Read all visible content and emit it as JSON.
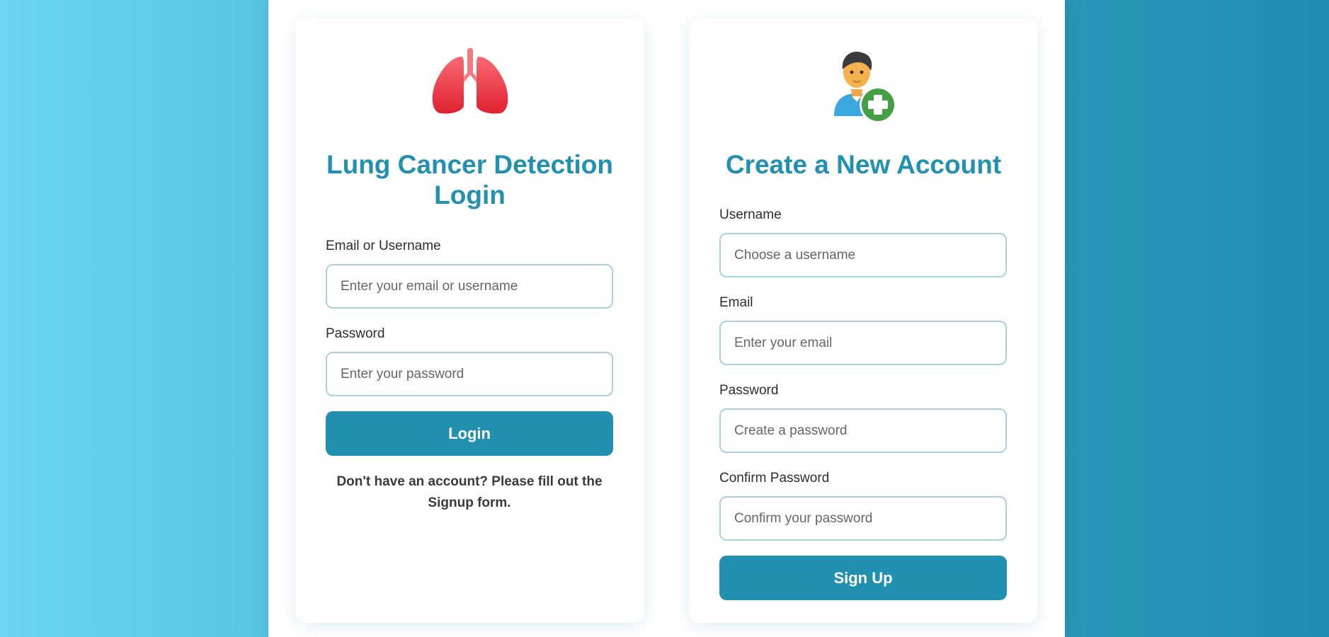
{
  "login": {
    "title": "Lung Cancer Detection Login",
    "icon": "lungs-icon",
    "email_label": "Email or Username",
    "email_placeholder": "Enter your email or username",
    "password_label": "Password",
    "password_placeholder": "Enter your password",
    "button_label": "Login",
    "note": "Don't have an account? Please fill out the Signup form."
  },
  "signup": {
    "title": "Create a New Account",
    "icon": "add-user-icon",
    "username_label": "Username",
    "username_placeholder": "Choose a username",
    "email_label": "Email",
    "email_placeholder": "Enter your email",
    "password_label": "Password",
    "password_placeholder": "Create a password",
    "confirm_label": "Confirm Password",
    "confirm_placeholder": "Confirm your password",
    "button_label": "Sign Up"
  },
  "colors": {
    "accent": "#2290b0",
    "lungs": "#e8323f",
    "add_badge": "#43a047"
  }
}
